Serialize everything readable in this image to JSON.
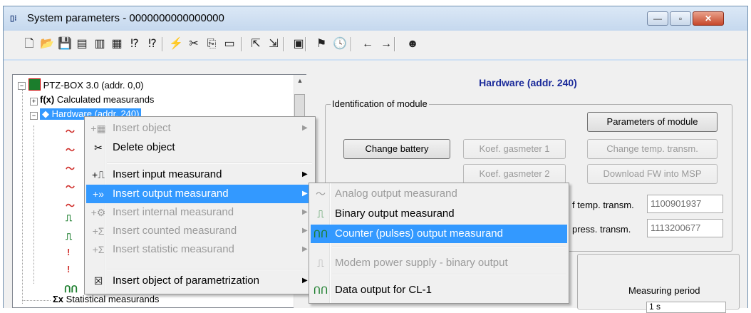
{
  "window": {
    "title": "System parameters - 0000000000000000",
    "icon_text": "▯⁝",
    "minimize": "—",
    "maximize": "▫",
    "close": "✕"
  },
  "toolbar": {
    "icons": [
      "new-icon",
      "open-icon",
      "save-icon",
      "doc-a-icon",
      "doc-b-icon",
      "doc-c-icon",
      "param-a-icon",
      "param-b-icon",
      "signal-icon",
      "cut-icon",
      "copy-icon",
      "paste-icon",
      "export-icon",
      "import-icon",
      "window-icon",
      "help-icon",
      "clock-icon",
      "back-icon",
      "forward-icon",
      "smiley-icon"
    ],
    "glyphs": [
      "🗋",
      "📂",
      "💾",
      "▤",
      "▥",
      "▦",
      "⁉",
      "⁉",
      "⚡",
      "✂",
      "⎘",
      "▭",
      "⇱",
      "⇲",
      "▣",
      "⚑",
      "🕓",
      "←",
      "→",
      "☻"
    ]
  },
  "tree": {
    "root": "PTZ-BOX 3.0 (addr. 0,0)",
    "calculated": "Calculated measurands",
    "calc_icon": "f(x)",
    "hardware": "Hardware (addr. 240)",
    "statistical": "Statistical measurands",
    "stat_icon": "Σx"
  },
  "right": {
    "title": "Hardware (addr. 240)",
    "group_ident_label": "Identification of module",
    "btn_parameters": "Parameters of module",
    "btn_change_battery": "Change battery",
    "btn_koef1": "Koef. gasmeter 1",
    "btn_change_temp": "Change temp. transm.",
    "btn_koef2": "Koef. gasmeter 2",
    "btn_download": "Download FW into MSP",
    "temp_label": "f temp. transm.",
    "temp_value": "1100901937",
    "press_label": "press. transm.",
    "press_value": "1113200677",
    "measuring_period": "Measuring period",
    "period_value": "1 s"
  },
  "context_menu": {
    "items": [
      {
        "label": "Insert object",
        "icon": "+▦",
        "disabled": true,
        "submenu": true
      },
      {
        "label": "Delete object",
        "icon": "✂",
        "disabled": false,
        "submenu": false
      },
      {
        "label": "Insert input measurand",
        "icon": "+⎍",
        "disabled": false,
        "submenu": true
      },
      {
        "label": "Insert output measurand",
        "icon": "+»",
        "disabled": false,
        "submenu": true,
        "highlighted": true
      },
      {
        "label": "Insert internal measurand",
        "icon": "+⚙",
        "disabled": true,
        "submenu": true
      },
      {
        "label": "Insert counted measurand",
        "icon": "+Σ",
        "disabled": true,
        "submenu": true
      },
      {
        "label": "Insert statistic measurand",
        "icon": "+Σ",
        "disabled": true,
        "submenu": true
      },
      {
        "label": "Insert object of parametrization",
        "icon": "☒",
        "disabled": false,
        "submenu": true
      }
    ]
  },
  "submenu": {
    "items": [
      {
        "label": "Analog output measurand",
        "icon": "〜",
        "disabled": true
      },
      {
        "label": "Binary output measurand",
        "icon": "⎍",
        "disabled": false
      },
      {
        "label": "Counter (pulses) output measurand",
        "icon": "ՈՈ",
        "disabled": false,
        "highlighted": true
      },
      {
        "label": "Modem power supply - binary output",
        "icon": "⎍",
        "disabled": true
      },
      {
        "label": "Data output for CL-1",
        "icon": "ՈՈ",
        "disabled": false
      }
    ]
  },
  "colors": {
    "highlight": "#3399ff",
    "title_blue": "#1a2a9a",
    "disabled": "#9b9b9b"
  }
}
